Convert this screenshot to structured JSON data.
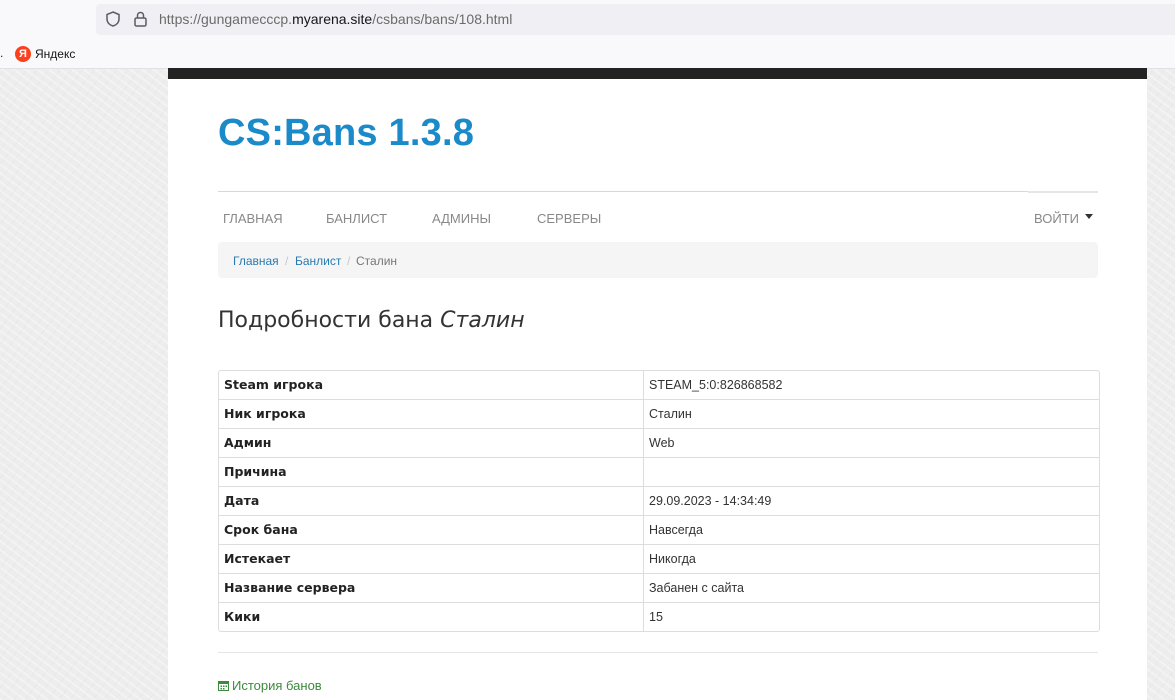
{
  "browser": {
    "url_prefix": "https://gungamecccp.",
    "url_domain": "myarena.site",
    "url_path": "/csbans/bans/108.html",
    "bookmark_dot": ".",
    "bookmark_icon_letter": "Я",
    "bookmark_label": "Яндекс",
    "icons": [
      "shield-icon",
      "lock-icon",
      "yandex-icon"
    ]
  },
  "site": {
    "brand": "CS:Bans 1.3.8",
    "brand_color": "#1a8ac9",
    "nav": {
      "home": "ГЛАВНАЯ",
      "banlist": "БАНЛИСТ",
      "admins": "АДМИНЫ",
      "servers": "СЕРВЕРЫ",
      "login": "ВОЙТИ"
    },
    "breadcrumb": {
      "home": "Главная",
      "banlist": "Банлист",
      "current": "Сталин",
      "separator": "/"
    },
    "title_prefix": "Подробности бана ",
    "title_name": "Сталин",
    "details": [
      {
        "label": "Steam игрока",
        "value": "STEAM_5:0:826868582"
      },
      {
        "label": "Ник игрока",
        "value": "Сталин"
      },
      {
        "label": "Админ",
        "value": "Web"
      },
      {
        "label": "Причина",
        "value": ""
      },
      {
        "label": "Дата",
        "value": "29.09.2023 - 14:34:49"
      },
      {
        "label": "Срок бана",
        "value": "Навсегда"
      },
      {
        "label": "Истекает",
        "value": "Никогда"
      },
      {
        "label": "Название сервера",
        "value": "Забанен с сайта"
      },
      {
        "label": "Кики",
        "value": "15"
      }
    ],
    "history_link": "История банов",
    "link_color": "#2a7ab0",
    "history_color": "#3c8a3c"
  }
}
